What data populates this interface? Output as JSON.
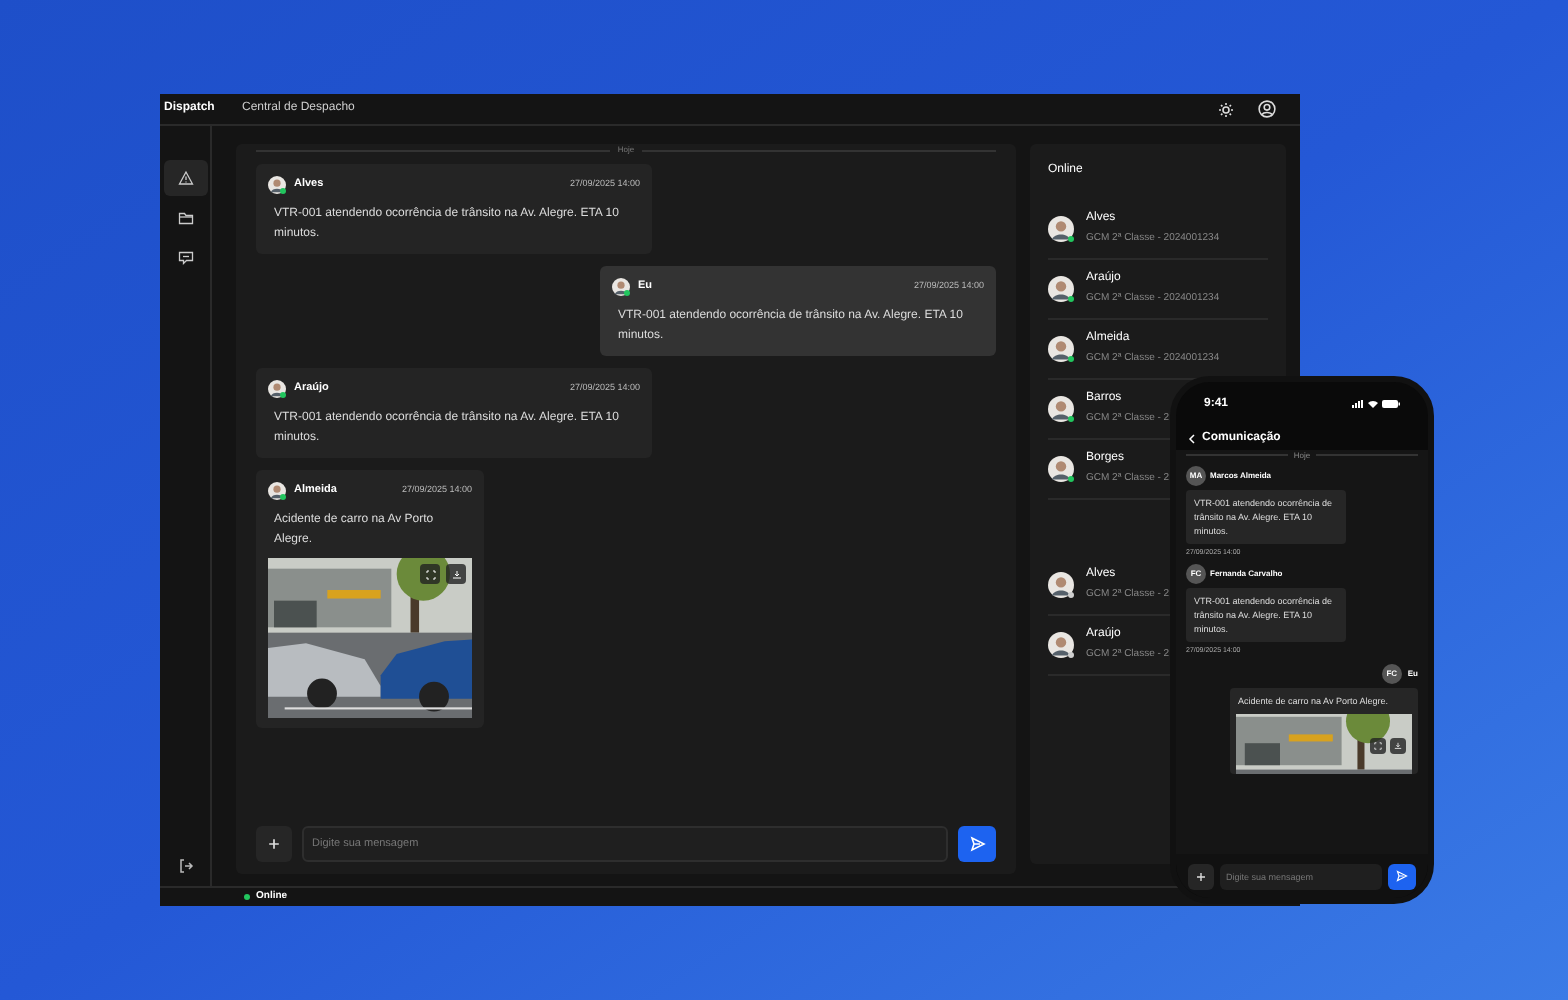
{
  "app": {
    "brand": "Dispatch",
    "title": "Central de Despacho"
  },
  "nav": [
    {
      "kind": "alert",
      "selected": true
    },
    {
      "kind": "folder",
      "selected": false
    },
    {
      "kind": "chat",
      "selected": false
    }
  ],
  "chat": {
    "divider": "Hoje",
    "messages": [
      {
        "author": "Alves",
        "time": "27/09/2025 14:00",
        "text": "VTR-001 atendendo ocorrência de trânsito na Av. Alegre. ETA 10 minutos.",
        "own": false,
        "kind": "text"
      },
      {
        "author": "Eu",
        "time": "27/09/2025 14:00",
        "text": "VTR-001 atendendo ocorrência de trânsito na Av. Alegre. ETA 10 minutos.",
        "own": true,
        "kind": "text"
      },
      {
        "author": "Araújo",
        "time": "27/09/2025 14:00",
        "text": "VTR-001 atendendo ocorrência de trânsito na Av. Alegre. ETA 10 minutos.",
        "own": false,
        "kind": "text"
      },
      {
        "author": "Almeida",
        "time": "27/09/2025 14:00",
        "text": "Acidente de carro na Av Porto Alegre.",
        "own": false
      }
    ]
  },
  "composer": {
    "placeholder": "Digite sua mensagem"
  },
  "online_panel": {
    "title": "Online",
    "users": [
      {
        "name": "Alves",
        "role": "GCM 2ª Classe - 2024001234",
        "online": true
      },
      {
        "name": "Araújo",
        "role": "GCM 2ª Classe - 2024001234",
        "online": true
      },
      {
        "name": "Almeida",
        "role": "GCM 2ª Classe - 2024001234",
        "online": true
      },
      {
        "name": "Barros",
        "role": "GCM 2ª Classe - 2",
        "online": true
      },
      {
        "name": "Borges",
        "role": "GCM 2ª Classe - 2",
        "online": true
      },
      {
        "name": "Alves",
        "role": "GCM 2ª Classe - 2",
        "online": false
      },
      {
        "name": "Araújo",
        "role": "GCM 2ª Classe - 2",
        "online": false
      }
    ]
  },
  "status_bar": {
    "text": "Online"
  },
  "phone": {
    "time": "9:41",
    "title": "Comunicação",
    "divider": "Hoje",
    "messages": [
      {
        "initials": "MA",
        "author": "Marcos Almeida",
        "text": "VTR-001 atendendo ocorrência de trânsito na Av. Alegre. ETA 10 minutos.",
        "time": "27/09/2025 14:00",
        "own": false,
        "kind": "text"
      },
      {
        "initials": "FC",
        "author": "Fernanda Carvalho",
        "text": "VTR-001 atendendo ocorrência de trânsito na Av. Alegre. ETA 10 minutos.",
        "time": "27/09/2025 14:00",
        "own": false,
        "kind": "text"
      },
      {
        "initials": "FC",
        "author": "Eu",
        "text": "Acidente de carro na Av Porto Alegre.",
        "own": true
      }
    ],
    "placeholder": "Digite sua mensagem"
  }
}
